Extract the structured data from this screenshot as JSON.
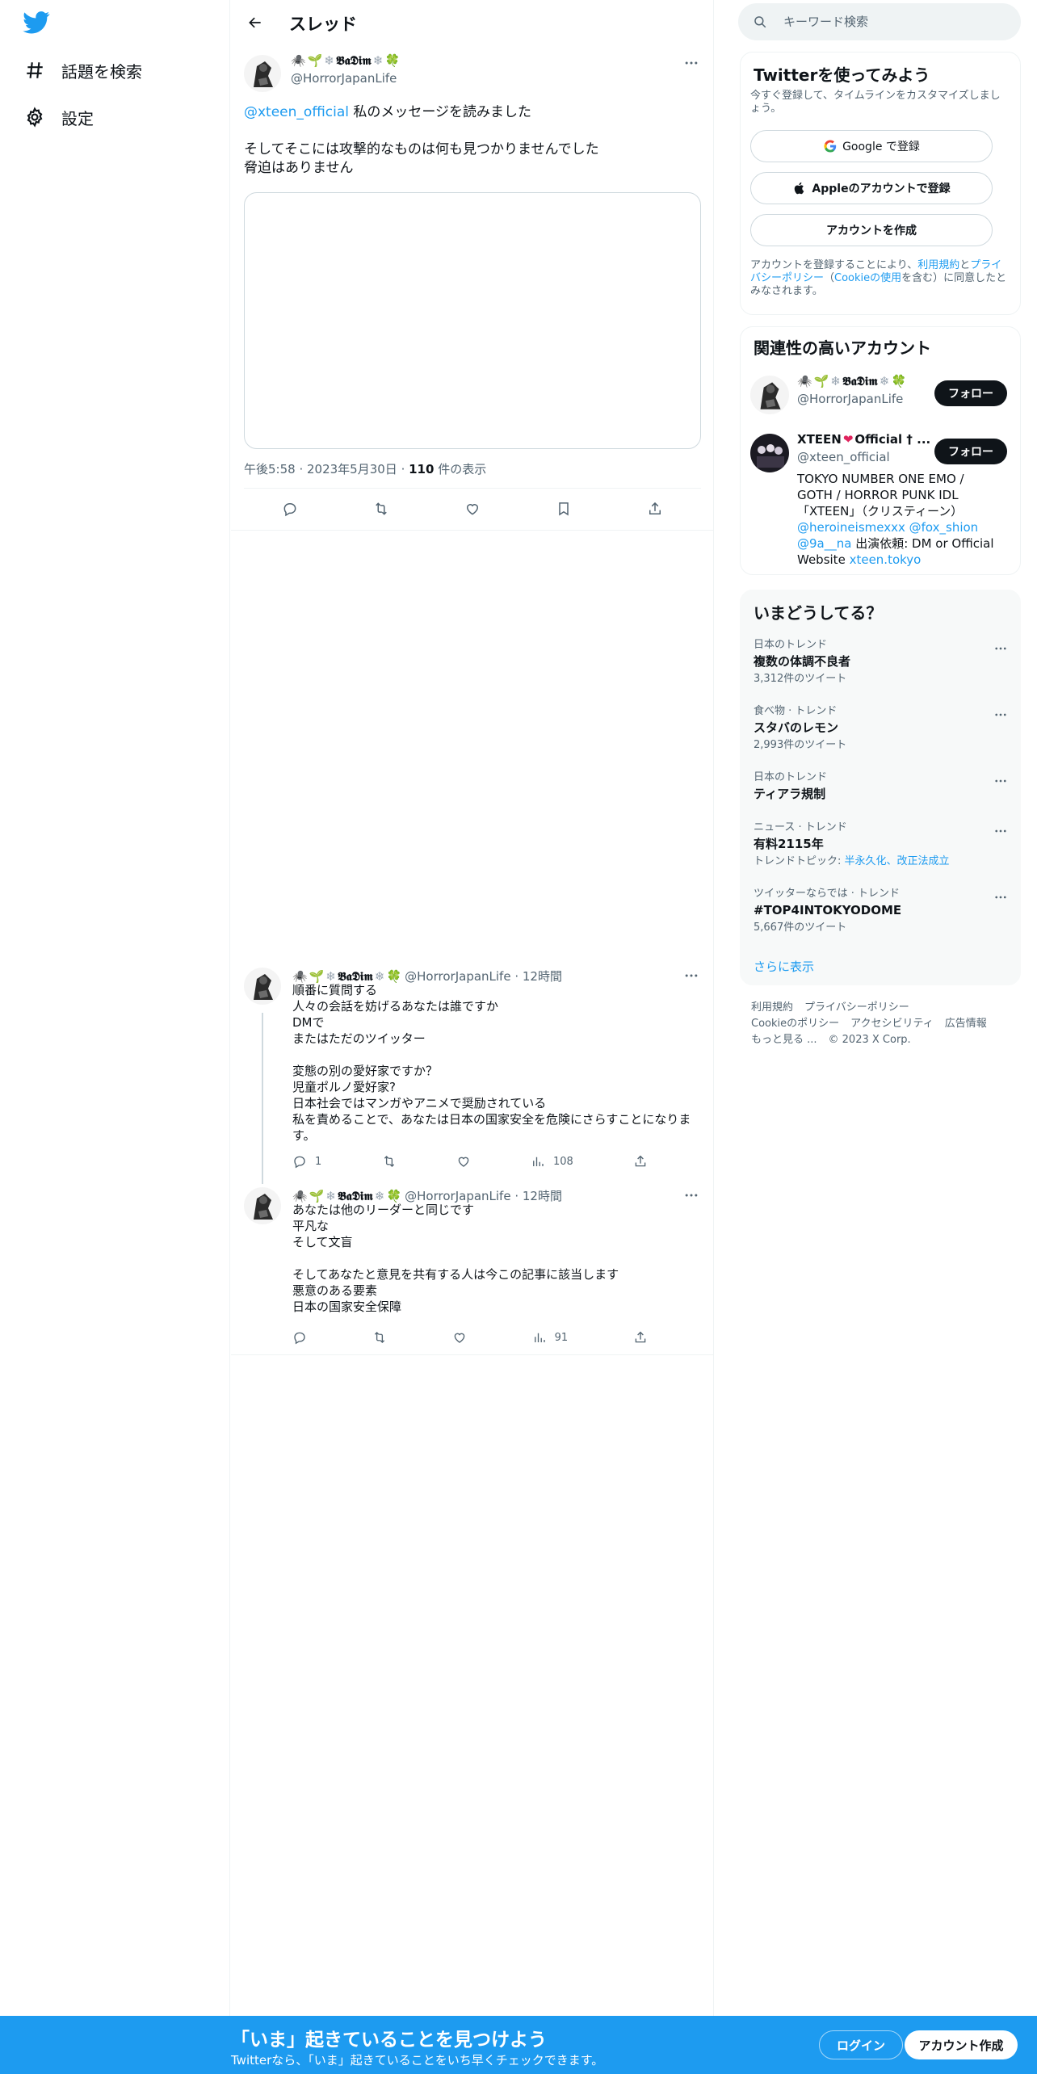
{
  "nav": {
    "explore_label": "話題を検索",
    "settings_label": "設定"
  },
  "thread": {
    "title": "スレッド"
  },
  "main_tweet": {
    "display_name": "𝕭𝖆𝕯𝖎𝖒",
    "handle": "@HorrorJapanLife",
    "mention": "@xteen_official",
    "line1_rest": " 私のメッセージを読みました",
    "line2": "そしてそこには攻撃的なものは何も見つかりませんでした",
    "line3": "脅迫はありません",
    "time": "午後5:58",
    "date": "2023年5月30日",
    "views_count": "110",
    "views_label": "件の表示"
  },
  "replies": [
    {
      "display_name": "𝕭𝖆𝕯𝖎𝖒",
      "handle": "@HorrorJapanLife",
      "age": "12時間",
      "text": "順番に質問する\n人々の会話を妨げるあなたは誰ですか\nDMで\nまたはただのツイッター\n\n変態の別の愛好家ですか？\n児童ポルノ愛好家?\n日本社会ではマンガやアニメで奨励されている\n私を責めることで、あなたは日本の国家安全を危険にさらすことになります。",
      "replies_count": "1",
      "views_count": "108"
    },
    {
      "display_name": "𝕭𝖆𝕯𝖎𝖒",
      "handle": "@HorrorJapanLife",
      "age": "12時間",
      "text": "あなたは他のリーダーと同じです\n平凡な\nそして文盲\n\nそしてあなたと意見を共有する人は今この記事に該当します\n悪意のある要素\n日本の国家安全保障",
      "replies_count": "",
      "views_count": "91"
    }
  ],
  "search": {
    "placeholder": "キーワード検索"
  },
  "signup": {
    "title": "Twitterを使ってみよう",
    "subtitle": "今すぐ登録して、タイムラインをカスタマイズしましょう。",
    "google_label": "Google で登録",
    "apple_label": "Appleのアカウントで登録",
    "create_label": "アカウントを作成",
    "legal_1": "アカウントを登録することにより、",
    "legal_terms": "利用規約",
    "legal_2": "と",
    "legal_privacy": "プライバシーポリシー",
    "legal_3": "（",
    "legal_cookie": "Cookieの使用",
    "legal_4": "を含む）に同意したとみなされます。"
  },
  "related": {
    "title": "関連性の高いアカウント",
    "accounts": [
      {
        "display_name": "𝕭𝖆𝕯𝖎𝖒",
        "handle": "@HorrorJapanLife",
        "follow_label": "フォロー"
      },
      {
        "display_name": "XTEEN",
        "display_name_suffix": "Official † ...",
        "handle": "@xteen_official",
        "follow_label": "フォロー",
        "bio_1": "TOKYO NUMBER ONE EMO / GOTH / HORROR PUNK IDL 「XTEEN」（クリスティーン）",
        "bio_link1": "@heroineismexxx",
        "bio_link2": "@fox_shion",
        "bio_link3": "@9a__na",
        "bio_2": " 出演依頼: DM or Official Website ",
        "bio_link4": "xteen.tokyo"
      }
    ]
  },
  "trends": {
    "title": "いまどうしてる？",
    "items": [
      {
        "context": "日本のトレンド",
        "name": "複数の体調不良者",
        "count": "3,312件のツイート"
      },
      {
        "context": "食べ物 · トレンド",
        "name": "スタバのレモン",
        "count": "2,993件のツイート"
      },
      {
        "context": "日本のトレンド",
        "name": "ティアラ規制",
        "count": ""
      },
      {
        "context": "ニュース · トレンド",
        "name": "有料2115年",
        "topic_label": "トレンドトピック: ",
        "topic_links": "半永久化、改正法成立"
      },
      {
        "context": "ツイッターならでは · トレンド",
        "name": "#TOP4INTOKYODOME",
        "count": "5,667件のツイート"
      }
    ],
    "show_more": "さらに表示"
  },
  "footer": {
    "terms": "利用規約",
    "privacy": "プライバシーポリシー",
    "cookie": "Cookieのポリシー",
    "accessibility": "アクセシビリティ",
    "ads": "広告情報",
    "more": "もっと見る ...",
    "copyright": "© 2023 X Corp."
  },
  "bottom_bar": {
    "title": "「いま」起きていることを見つけよう",
    "subtitle": "Twitterなら、「いま」起きていることをいち早くチェックできます。",
    "login_label": "ログイン",
    "signup_label": "アカウント作成"
  },
  "colors": {
    "accent": "#1d9bf0",
    "text": "#0f1419",
    "secondary": "#536471"
  }
}
